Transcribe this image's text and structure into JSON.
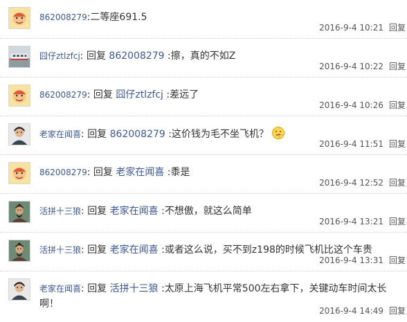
{
  "comments": [
    {
      "user": "862008279",
      "avatar": "cartoon-face-avatar",
      "reply_to": "",
      "text": "二等座691.5",
      "time": "2016-9-4 10:21",
      "reply_label": "回复"
    },
    {
      "user": "囧仔ztlzfcj",
      "avatar": "train-photo-avatar",
      "reply_word": "回复",
      "reply_to": "862008279",
      "text": "擦，真的不如Z",
      "time": "2016-9-4 10:22",
      "reply_label": "回复"
    },
    {
      "user": "862008279",
      "avatar": "cartoon-face-avatar",
      "reply_word": "回复",
      "reply_to": "囧仔ztlzfcj",
      "text": "差远了",
      "time": "2016-9-4 10:26",
      "reply_label": "回复"
    },
    {
      "user": "老家在闻喜",
      "avatar": "person-portrait-avatar",
      "reply_word": "回复",
      "reply_to": "862008279",
      "text": "这价钱为毛不坐飞机？",
      "emoticon": "thinking-emoticon",
      "time": "2016-9-4 11:51",
      "reply_label": "回复"
    },
    {
      "user": "862008279",
      "avatar": "cartoon-face-avatar",
      "reply_word": "回复",
      "reply_to": "老家在闻喜",
      "text": "黍是",
      "time": "2016-9-4 12:52",
      "reply_label": "回复"
    },
    {
      "user": "活拼十三狼",
      "avatar": "warrior-portrait-avatar",
      "reply_word": "回复",
      "reply_to": "老家在闻喜",
      "text": "不想傲，就这么简单",
      "time": "2016-9-4 13:21",
      "reply_label": "回复"
    },
    {
      "user": "活拼十三狼",
      "avatar": "warrior-portrait-avatar",
      "reply_word": "回复",
      "reply_to": "老家在闻喜",
      "text": "或者这么说，买不到z198的时候飞机比这个车贵",
      "time": "2016-9-4 13:31",
      "reply_label": "回复"
    },
    {
      "user": "老家在闻喜",
      "avatar": "person-portrait-avatar",
      "reply_word": "回复",
      "reply_to": "活拼十三狼",
      "text": "太原上海飞机平常500左右拿下，关键动车时间太长啊！",
      "time": "2016-9-4 14:49",
      "reply_label": "回复"
    }
  ]
}
